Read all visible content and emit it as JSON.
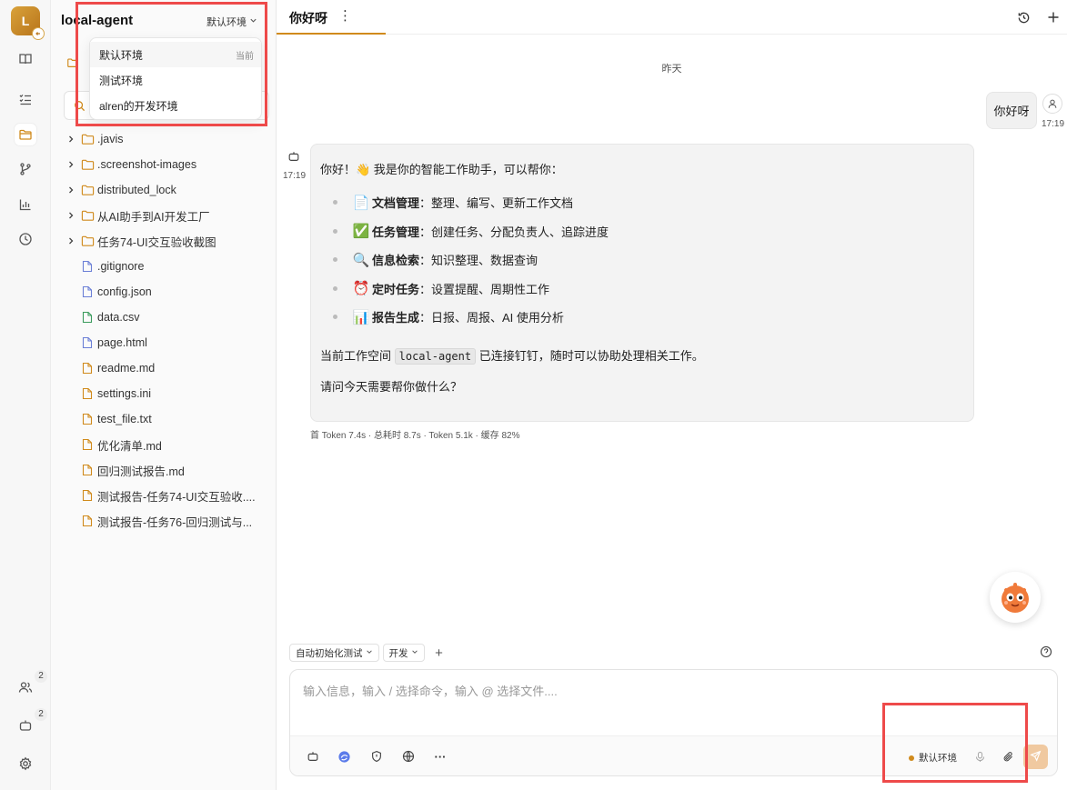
{
  "rail": {
    "avatar_letter": "L",
    "team_badge": "2",
    "bot_badge": "2",
    "items": [
      {
        "name": "book-icon"
      },
      {
        "name": "checklist-icon"
      },
      {
        "name": "folder-icon"
      },
      {
        "name": "branch-icon"
      },
      {
        "name": "bar-chart-icon"
      },
      {
        "name": "clock-icon"
      }
    ]
  },
  "sidebar": {
    "workspace_title": "local-agent",
    "env_selected": "默认环境",
    "env_dropdown": {
      "current_label": "当前",
      "options": [
        "默认环境",
        "测试环境",
        "alren的开发环境"
      ]
    },
    "tree": [
      {
        "type": "folder",
        "label": ".javis"
      },
      {
        "type": "folder",
        "label": ".screenshot-images"
      },
      {
        "type": "folder",
        "label": "distributed_lock"
      },
      {
        "type": "folder",
        "label": "从AI助手到AI开发工厂"
      },
      {
        "type": "folder",
        "label": "任务74-UI交互验收截图"
      },
      {
        "type": "file",
        "label": ".gitignore",
        "color": "#6b7fd6"
      },
      {
        "type": "file",
        "label": "config.json",
        "color": "#6b7fd6"
      },
      {
        "type": "file",
        "label": "data.csv",
        "color": "#3a9b5c"
      },
      {
        "type": "file",
        "label": "page.html",
        "color": "#6b7fd6"
      },
      {
        "type": "file",
        "label": "readme.md",
        "color": "#d08a1c"
      },
      {
        "type": "file",
        "label": "settings.ini",
        "color": "#d08a1c"
      },
      {
        "type": "file",
        "label": "test_file.txt",
        "color": "#d08a1c"
      },
      {
        "type": "file",
        "label": "优化清单.md",
        "color": "#d08a1c"
      },
      {
        "type": "file",
        "label": "回归测试报告.md",
        "color": "#d08a1c"
      },
      {
        "type": "file",
        "label": "测试报告-任务74-UI交互验收....",
        "color": "#d08a1c"
      },
      {
        "type": "file",
        "label": "测试报告-任务76-回归测试与...",
        "color": "#d08a1c"
      }
    ]
  },
  "main": {
    "tab_title": "你好呀",
    "tab_more": "⋮",
    "date_separator": "昨天",
    "user_message": {
      "text": "你好呀",
      "time": "17:19"
    },
    "bot_message": {
      "time": "17:19",
      "intro": "你好！👋 我是你的智能工作助手，可以帮你：",
      "items": [
        {
          "emoji": "📄",
          "title": "文档管理",
          "desc": "：整理、编写、更新工作文档"
        },
        {
          "emoji": "✅",
          "title": "任务管理",
          "desc": "：创建任务、分配负责人、追踪进度"
        },
        {
          "emoji": "🔍",
          "title": "信息检索",
          "desc": "：知识整理、数据查询"
        },
        {
          "emoji": "⏰",
          "title": "定时任务",
          "desc": "：设置提醒、周期性工作"
        },
        {
          "emoji": "📊",
          "title": "报告生成",
          "desc": "：日报、周报、AI 使用分析"
        }
      ],
      "workspace_pre": "当前工作空间 ",
      "workspace_code": "local-agent",
      "workspace_post": " 已连接钉钉，随时可以协助处理相关工作。",
      "question": "请问今天需要帮你做什么？",
      "stats": "首 Token 7.4s · 总耗时 8.7s · Token 5.1k · 缓存 82%"
    },
    "chips": [
      "自动初始化测试",
      "开发"
    ],
    "chip_add": "+",
    "composer": {
      "placeholder": "输入信息，输入 / 选择命令，输入 @ 选择文件....",
      "env_label": "默认环境",
      "more": "···"
    }
  },
  "colors": {
    "accent": "#d08a1c",
    "highlight_box": "#ee4a4a"
  }
}
